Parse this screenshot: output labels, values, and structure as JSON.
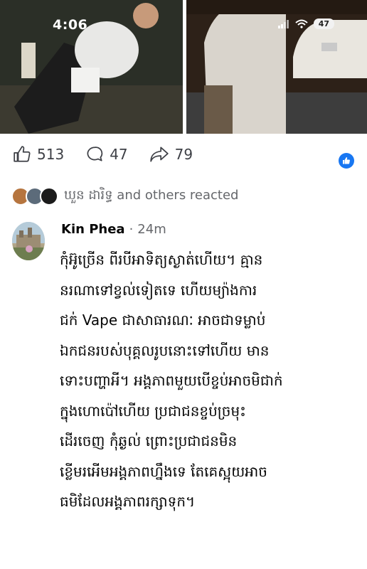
{
  "status_bar": {
    "time": "4:06",
    "battery": "47"
  },
  "post_actions": {
    "likes": "513",
    "comments": "47",
    "shares": "79"
  },
  "reactions": {
    "text": "ឃួន ដារិទ្ធ and others reacted"
  },
  "comment": {
    "author": "Kin Phea",
    "separator": "·",
    "time": "24m",
    "lines": [
      "កុំអ៊ូច្រើន ពីរបីអាទិត្យស្ងាត់ហើយ។ គ្មាន",
      "នរណាទៅខ្វល់ទៀតទេ ហើយម្យ៉ាងការ",
      "ជក់ Vape ជាសាធារណៈ អាចជាទម្លាប់",
      "ឯកជនរបស់បុគ្គលរូបនោះទៅហើយ មាន",
      "ទោះបញ្ហាអី។ អង្គភាពមួយបើខ្ចប់អាចមិជាក់",
      "ក្នុងហោប៉ៅហើយ ប្រជាជនខ្ចប់ច្រមុះ",
      "ដើរចេញ កុំឆ្ងល់ ព្រោះប្រជាជនមិន",
      "ខ្លើមរអើមអង្គភាពហ្នឹងទេ តែគេស្អុយអាច",
      "ធមិដែលអង្គភាពរក្សាទុក។"
    ]
  },
  "colors": {
    "accent": "#1877f2",
    "secondary_text": "#65676b",
    "primary_text": "#050505"
  }
}
